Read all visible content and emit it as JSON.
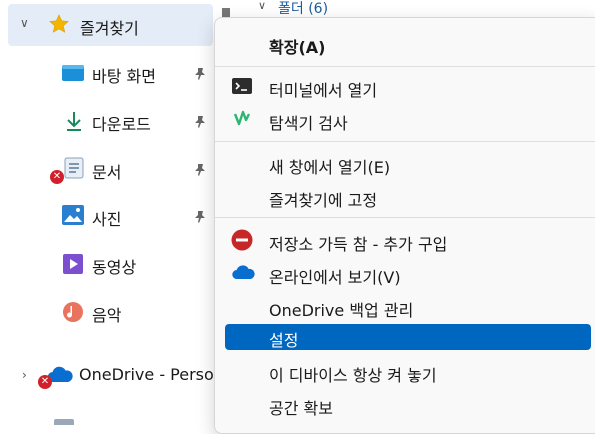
{
  "nav": {
    "favorites": "즐겨찾기",
    "items": [
      {
        "label": "바탕 화면",
        "pinned": true
      },
      {
        "label": "다운로드",
        "pinned": true
      },
      {
        "label": "문서",
        "pinned": true
      },
      {
        "label": "사진",
        "pinned": true
      },
      {
        "label": "동영상"
      },
      {
        "label": "음악"
      }
    ],
    "onedrive": "OneDrive - Perso"
  },
  "content": {
    "group_title": "폴더 (6)"
  },
  "menu": {
    "items": [
      {
        "label": "확장(A)",
        "icon": "none"
      },
      {
        "label": "터미널에서 열기",
        "icon": "terminal-icon"
      },
      {
        "label": "탐색기 검사",
        "icon": "scan-icon"
      },
      {
        "label": "새 창에서 열기(E)",
        "icon": "none"
      },
      {
        "label": "즐겨찾기에 고정",
        "icon": "none"
      },
      {
        "label": "저장소 가득 참 - 추가 구입",
        "icon": "storage-full-icon"
      },
      {
        "label": "온라인에서 보기(V)",
        "icon": "onedrive-cloud-icon"
      },
      {
        "label": "OneDrive 백업 관리",
        "icon": "none"
      },
      {
        "label": "설정",
        "icon": "none",
        "selected": true
      },
      {
        "label": "이 디바이스 항상 켜 놓기",
        "icon": "none"
      },
      {
        "label": "공간 확보",
        "icon": "none"
      }
    ]
  },
  "colors": {
    "accent": "#0067c0",
    "nav_highlight": "#e4ecf7",
    "error": "#d1202a",
    "star": "#f4b400",
    "terminal": "#2d2d2d",
    "scan": "#2bb673",
    "onedrive": "#0a6ed1"
  }
}
